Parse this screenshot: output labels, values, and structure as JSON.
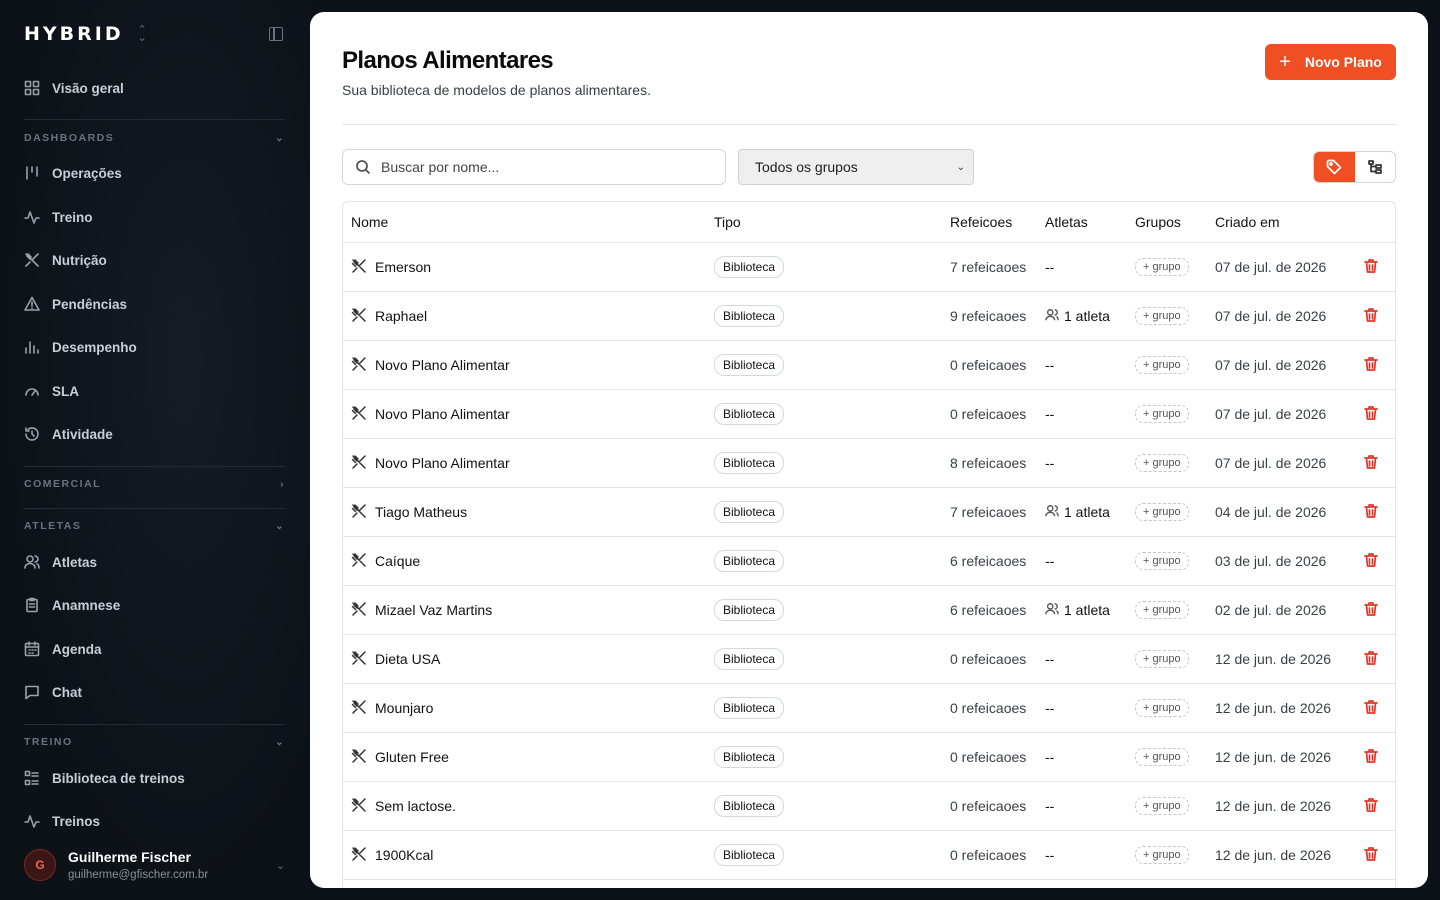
{
  "brand": {
    "logo": "HYBRID",
    "switch_glyph": "⌃⌄"
  },
  "sidebar": {
    "overview": "Visão geral",
    "sections": {
      "dashboards": "DASHBOARDS",
      "comercial": "COMERCIAL",
      "atletas": "ATLETAS",
      "treino": "TREINO"
    },
    "items": {
      "operacoes": "Operações",
      "treino": "Treino",
      "nutricao": "Nutrição",
      "pendencias": "Pendências",
      "desempenho": "Desempenho",
      "sla": "SLA",
      "atividade": "Atividade",
      "atletas": "Atletas",
      "anamnese": "Anamnese",
      "agenda": "Agenda",
      "chat": "Chat",
      "biblioteca": "Biblioteca de treinos",
      "treinos": "Treinos"
    }
  },
  "user": {
    "initial": "G",
    "name": "Guilherme Fischer",
    "email": "guilherme@gfischer.com.br"
  },
  "page": {
    "title": "Planos Alimentares",
    "subtitle": "Sua biblioteca de modelos de planos alimentares.",
    "new_button": "Novo Plano",
    "search_placeholder": "Buscar por nome...",
    "group_filter": "Todos os grupos"
  },
  "table": {
    "headers": {
      "name": "Nome",
      "type": "Tipo",
      "meals": "Refeicoes",
      "athletes": "Atletas",
      "groups": "Grupos",
      "created": "Criado em"
    },
    "rows": [
      {
        "name": "Emerson",
        "type": "Biblioteca",
        "meals": "7 refeicaoes",
        "athletes": "--",
        "group": "+ grupo",
        "created": "07 de jul. de 2026"
      },
      {
        "name": "Raphael",
        "type": "Biblioteca",
        "meals": "9 refeicaoes",
        "athletes": "1 atleta",
        "group": "+ grupo",
        "created": "07 de jul. de 2026"
      },
      {
        "name": "Novo Plano Alimentar",
        "type": "Biblioteca",
        "meals": "0 refeicaoes",
        "athletes": "--",
        "group": "+ grupo",
        "created": "07 de jul. de 2026"
      },
      {
        "name": "Novo Plano Alimentar",
        "type": "Biblioteca",
        "meals": "0 refeicaoes",
        "athletes": "--",
        "group": "+ grupo",
        "created": "07 de jul. de 2026"
      },
      {
        "name": "Novo Plano Alimentar",
        "type": "Biblioteca",
        "meals": "8 refeicaoes",
        "athletes": "--",
        "group": "+ grupo",
        "created": "07 de jul. de 2026"
      },
      {
        "name": "Tiago Matheus",
        "type": "Biblioteca",
        "meals": "7 refeicaoes",
        "athletes": "1 atleta",
        "group": "+ grupo",
        "created": "04 de jul. de 2026"
      },
      {
        "name": "Caíque",
        "type": "Biblioteca",
        "meals": "6 refeicaoes",
        "athletes": "--",
        "group": "+ grupo",
        "created": "03 de jul. de 2026"
      },
      {
        "name": "Mizael Vaz Martins",
        "type": "Biblioteca",
        "meals": "6 refeicaoes",
        "athletes": "1 atleta",
        "group": "+ grupo",
        "created": "02 de jul. de 2026"
      },
      {
        "name": "Dieta USA",
        "type": "Biblioteca",
        "meals": "0 refeicaoes",
        "athletes": "--",
        "group": "+ grupo",
        "created": "12 de jun. de 2026"
      },
      {
        "name": "Mounjaro",
        "type": "Biblioteca",
        "meals": "0 refeicaoes",
        "athletes": "--",
        "group": "+ grupo",
        "created": "12 de jun. de 2026"
      },
      {
        "name": "Gluten Free",
        "type": "Biblioteca",
        "meals": "0 refeicaoes",
        "athletes": "--",
        "group": "+ grupo",
        "created": "12 de jun. de 2026"
      },
      {
        "name": "Sem lactose.",
        "type": "Biblioteca",
        "meals": "0 refeicaoes",
        "athletes": "--",
        "group": "+ grupo",
        "created": "12 de jun. de 2026"
      },
      {
        "name": "1900Kcal",
        "type": "Biblioteca",
        "meals": "0 refeicaoes",
        "athletes": "--",
        "group": "+ grupo",
        "created": "12 de jun. de 2026"
      }
    ]
  },
  "colors": {
    "accent": "#f04e23",
    "danger": "#e0372a",
    "sidebar_bg": "#0d1118"
  }
}
